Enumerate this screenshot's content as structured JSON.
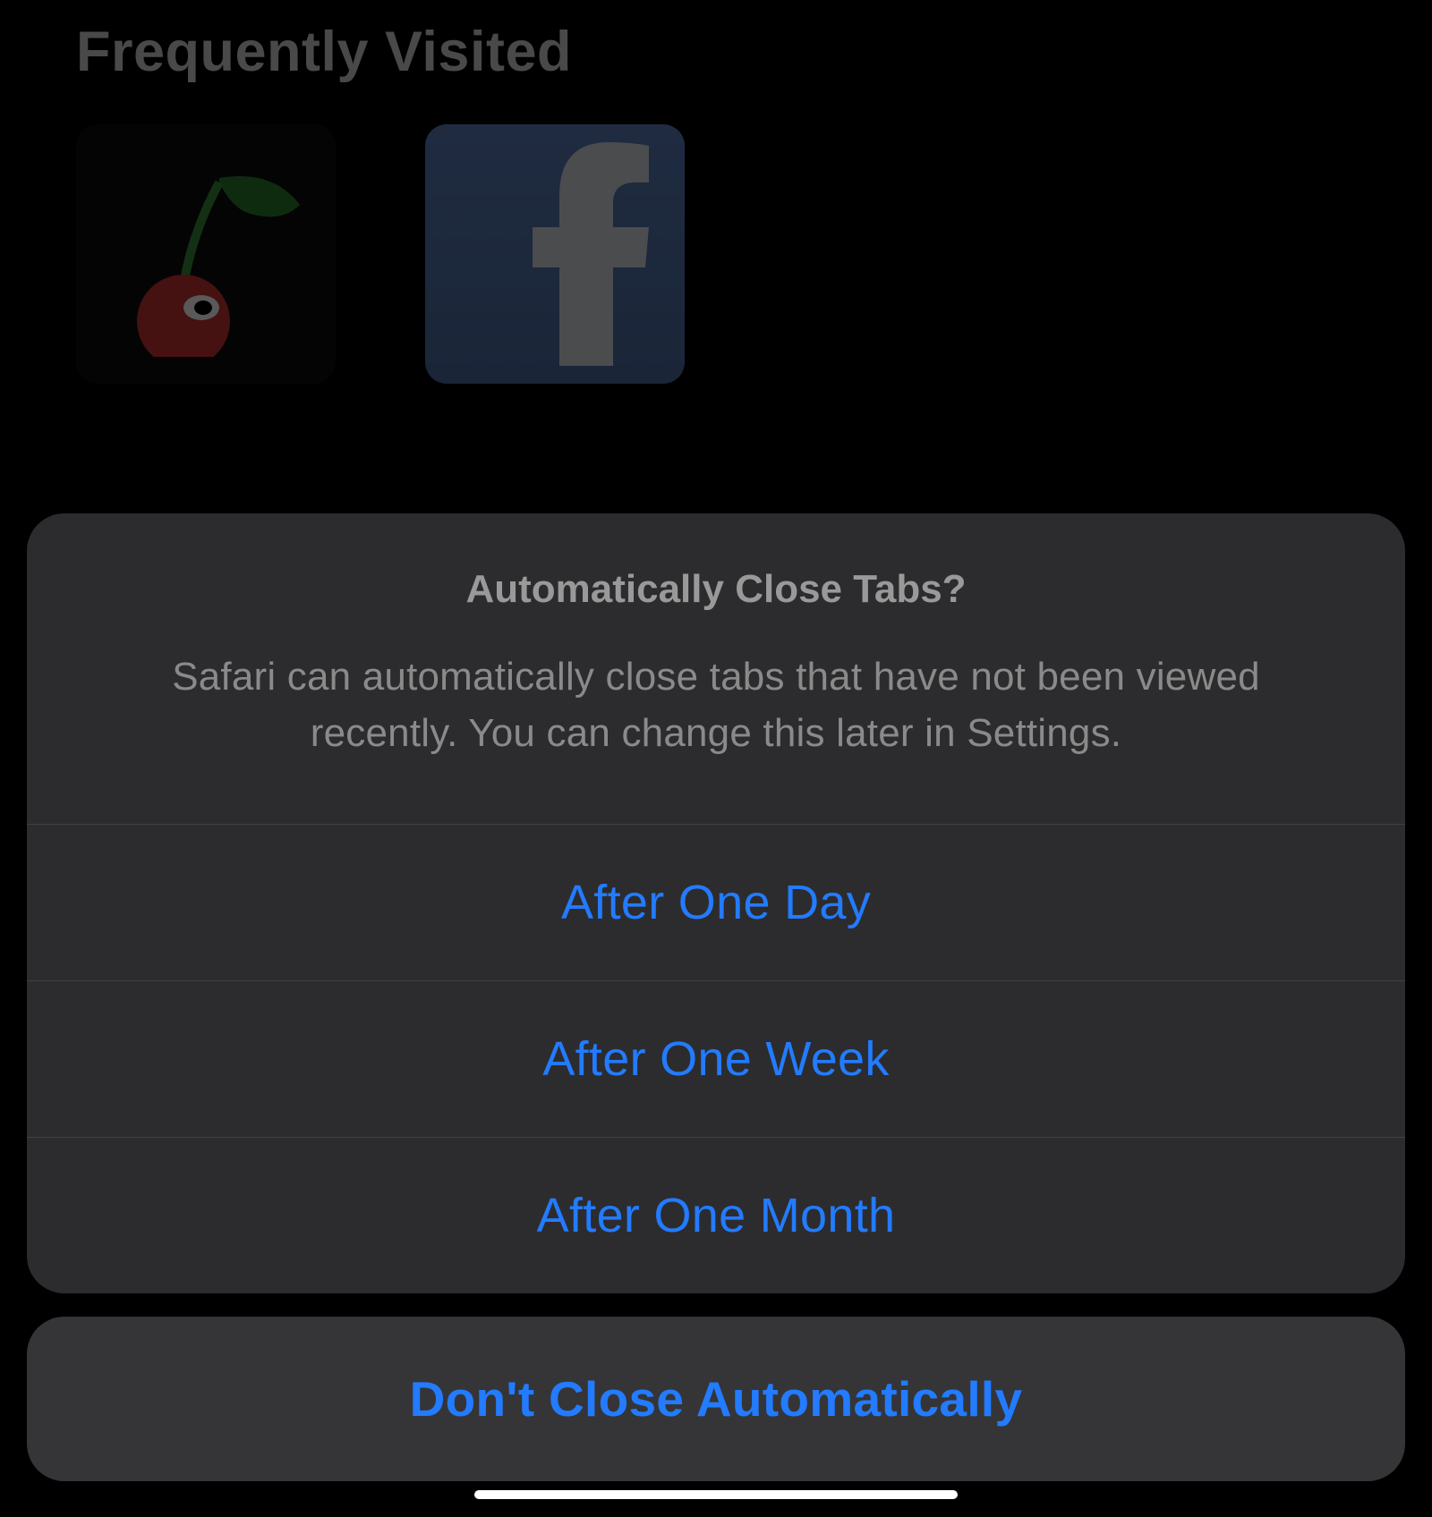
{
  "background": {
    "section_title": "Frequently Visited",
    "tiles": [
      {
        "name": "cherry-site",
        "icon": "cherry"
      },
      {
        "name": "facebook",
        "icon": "facebook"
      }
    ]
  },
  "action_sheet": {
    "title": "Automatically Close Tabs?",
    "message": "Safari can automatically close tabs that have not been viewed recently. You can change this later in Settings.",
    "options": [
      {
        "label": "After One Day"
      },
      {
        "label": "After One Week"
      },
      {
        "label": "After One Month"
      }
    ],
    "cancel_label": "Don't Close Automatically"
  },
  "colors": {
    "accent": "#237bff",
    "sheet_bg": "rgba(48,48,50,0.92)",
    "cancel_bg": "rgba(56,56,58,0.94)"
  }
}
